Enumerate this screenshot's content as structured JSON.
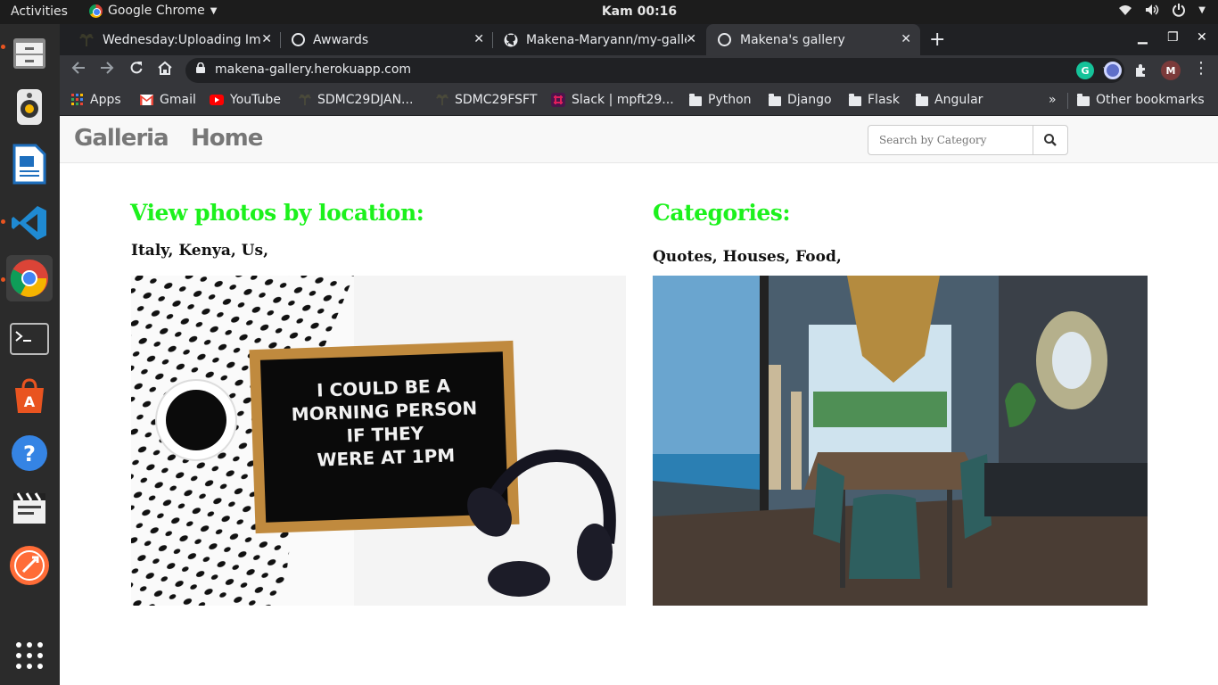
{
  "system": {
    "activities": "Activities",
    "app_name": "Google Chrome",
    "clock": "Kam 00:16"
  },
  "tabs": [
    {
      "title": "Wednesday:Uploading Im"
    },
    {
      "title": "Awwards"
    },
    {
      "title": "Makena-Maryann/my-galle"
    },
    {
      "title": "Makena's gallery"
    }
  ],
  "toolbar": {
    "url": "makena-gallery.herokuapp.com",
    "profile_initial": "M",
    "grammarly_initial": "G"
  },
  "bookmarks": {
    "items": [
      "Apps",
      "Gmail",
      "YouTube",
      "SDMC29DJAN...",
      "SDMC29FSFT",
      "Slack | mpft29...",
      "Python",
      "Django",
      "Flask",
      "Angular"
    ],
    "overflow": "»",
    "other": "Other bookmarks"
  },
  "site": {
    "brand": "Galleria",
    "nav_home": "Home",
    "search_placeholder": "Search by Category",
    "locations_title": "View photos by location:",
    "locations_list": "Italy, Kenya, Us,",
    "categories_title": "Categories:",
    "categories_list": "Quotes, Houses, Food,",
    "letter_board_text": [
      "I COULD BE A",
      "MORNING PERSON",
      "IF THEY",
      "WERE AT 1PM"
    ]
  }
}
